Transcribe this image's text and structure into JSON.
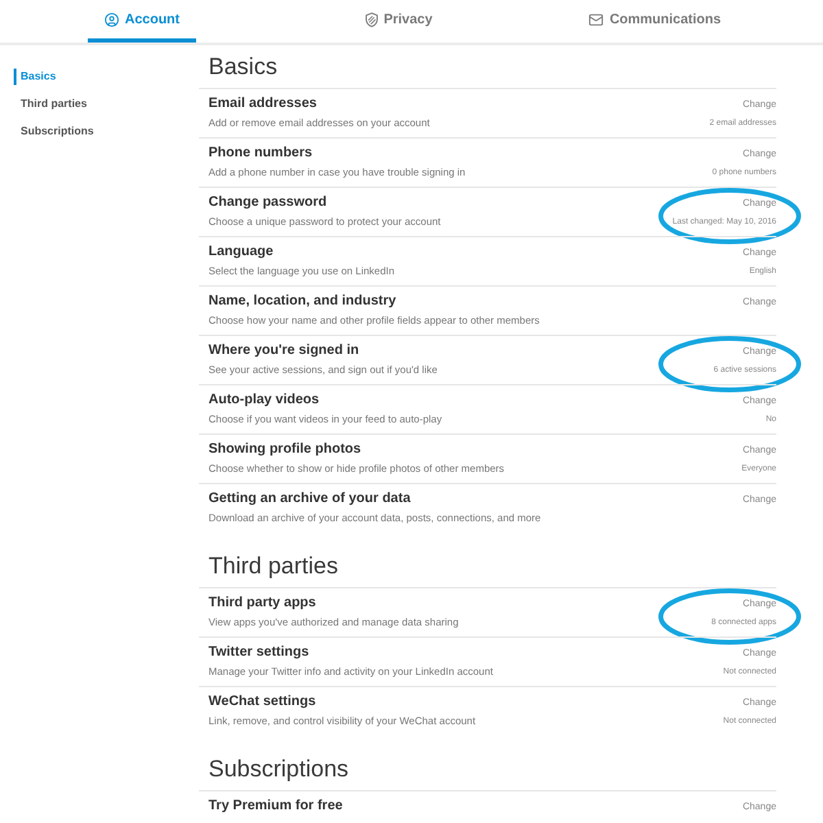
{
  "tabs": [
    {
      "label": "Account",
      "selected": true
    },
    {
      "label": "Privacy",
      "selected": false
    },
    {
      "label": "Communications",
      "selected": false
    }
  ],
  "sidebar": {
    "items": [
      {
        "label": "Basics",
        "selected": true
      },
      {
        "label": "Third parties",
        "selected": false
      },
      {
        "label": "Subscriptions",
        "selected": false
      }
    ]
  },
  "sections": [
    {
      "heading": "Basics",
      "rows": [
        {
          "title": "Email addresses",
          "description": "Add or remove email addresses on your account",
          "action": "Change",
          "value": "2 email addresses",
          "highlighted": false
        },
        {
          "title": "Phone numbers",
          "description": "Add a phone number in case you have trouble signing in",
          "action": "Change",
          "value": "0 phone numbers",
          "highlighted": false
        },
        {
          "title": "Change password",
          "description": "Choose a unique password to protect your account",
          "action": "Change",
          "value": "Last changed: May 10, 2016",
          "highlighted": true
        },
        {
          "title": "Language",
          "description": "Select the language you use on LinkedIn",
          "action": "Change",
          "value": "English",
          "highlighted": false
        },
        {
          "title": "Name, location, and industry",
          "description": "Choose how your name and other profile fields appear to other members",
          "action": "Change",
          "highlighted": false
        },
        {
          "title": "Where you're signed in",
          "description": "See your active sessions, and sign out if you'd like",
          "action": "Change",
          "value": "6 active sessions",
          "highlighted": true
        },
        {
          "title": "Auto-play videos",
          "description": "Choose if you want videos in your feed to auto-play",
          "action": "Change",
          "value": "No",
          "highlighted": false
        },
        {
          "title": "Showing profile photos",
          "description": "Choose whether to show or hide profile photos of other members",
          "action": "Change",
          "value": "Everyone",
          "highlighted": false
        },
        {
          "title": "Getting an archive of your data",
          "description": "Download an archive of your account data, posts, connections, and more",
          "action": "Change",
          "highlighted": false
        }
      ]
    },
    {
      "heading": "Third parties",
      "rows": [
        {
          "title": "Third party apps",
          "description": "View apps you've authorized and manage data sharing",
          "action": "Change",
          "value": "8 connected apps",
          "highlighted": true
        },
        {
          "title": "Twitter settings",
          "description": "Manage your Twitter info and activity on your LinkedIn account",
          "action": "Change",
          "value": "Not connected",
          "highlighted": false
        },
        {
          "title": "WeChat settings",
          "description": "Link, remove, and control visibility of your WeChat account",
          "action": "Change",
          "value": "Not connected",
          "highlighted": false
        }
      ]
    },
    {
      "heading": "Subscriptions",
      "rows": [
        {
          "title": "Try Premium for free",
          "action": "Change",
          "highlighted": false
        }
      ]
    }
  ]
}
